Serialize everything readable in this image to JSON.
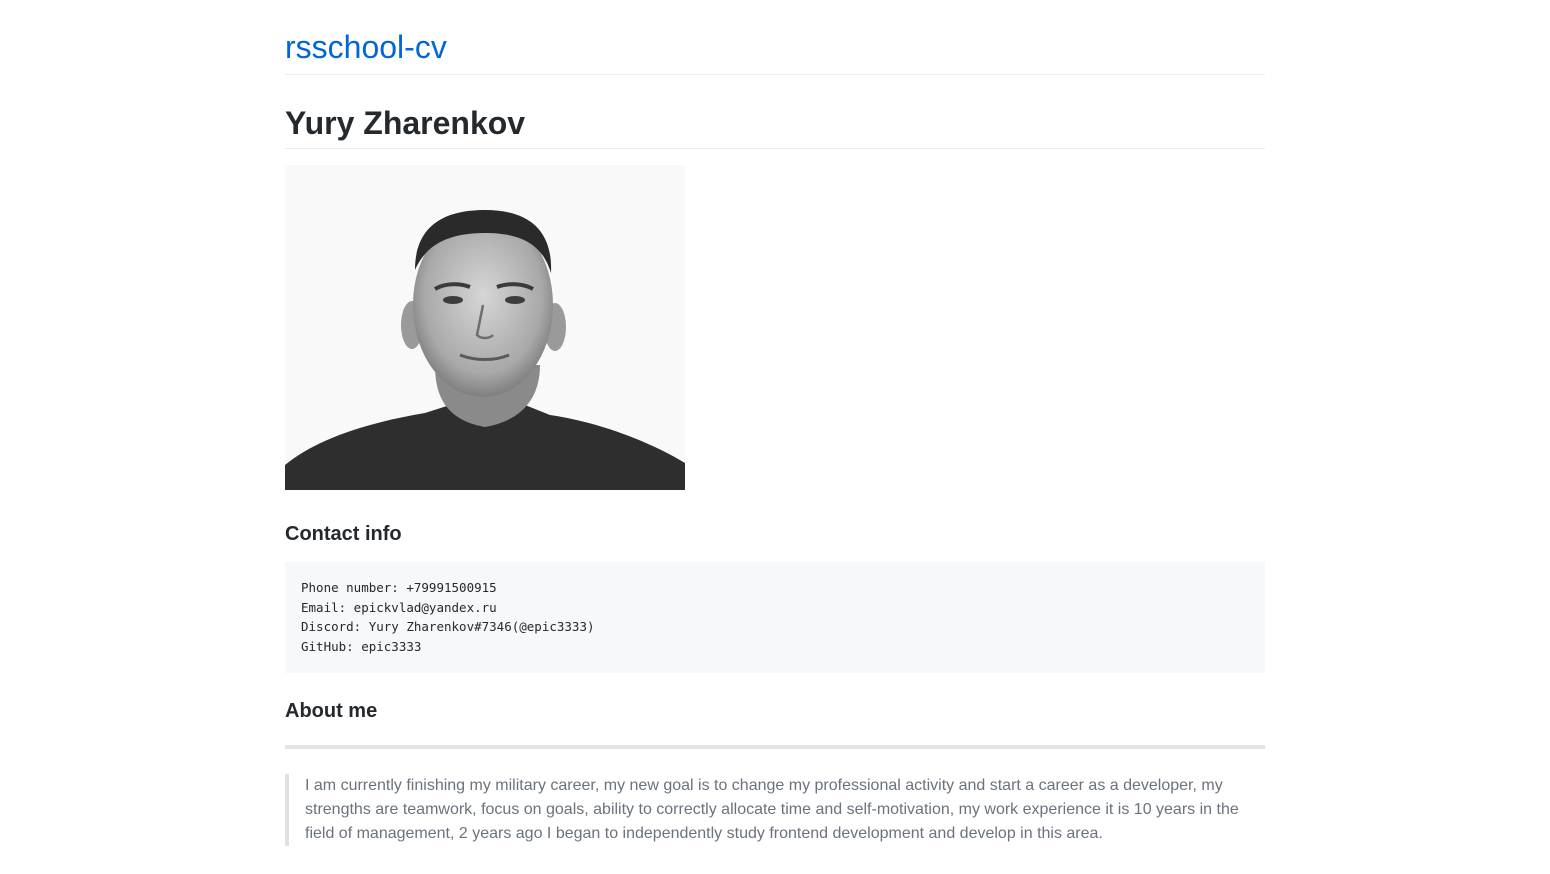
{
  "header": {
    "site_title": "rsschool-cv"
  },
  "main": {
    "name": "Yury Zharenkov",
    "contact_heading": "Contact info",
    "contact_lines": [
      "Phone number: +79991500915",
      "Email: epickvlad@yandex.ru",
      "Discord: Yury Zharenkov#7346(@epic3333)",
      "GitHub: epic3333"
    ],
    "about_heading": "About me",
    "about_text": "I am currently finishing my military career, my new goal is to change my professional activity and start a career as a developer, my strengths are teamwork, focus on goals, ability to correctly allocate time and self-motivation, my work experience it is 10 years in the field of management, 2 years ago I began to independently study frontend development and develop in this area."
  },
  "colors": {
    "link": "#0366d6",
    "text": "#24292e",
    "muted": "#6a737d",
    "code_bg": "#f6f8fa",
    "border": "#eaecef"
  }
}
